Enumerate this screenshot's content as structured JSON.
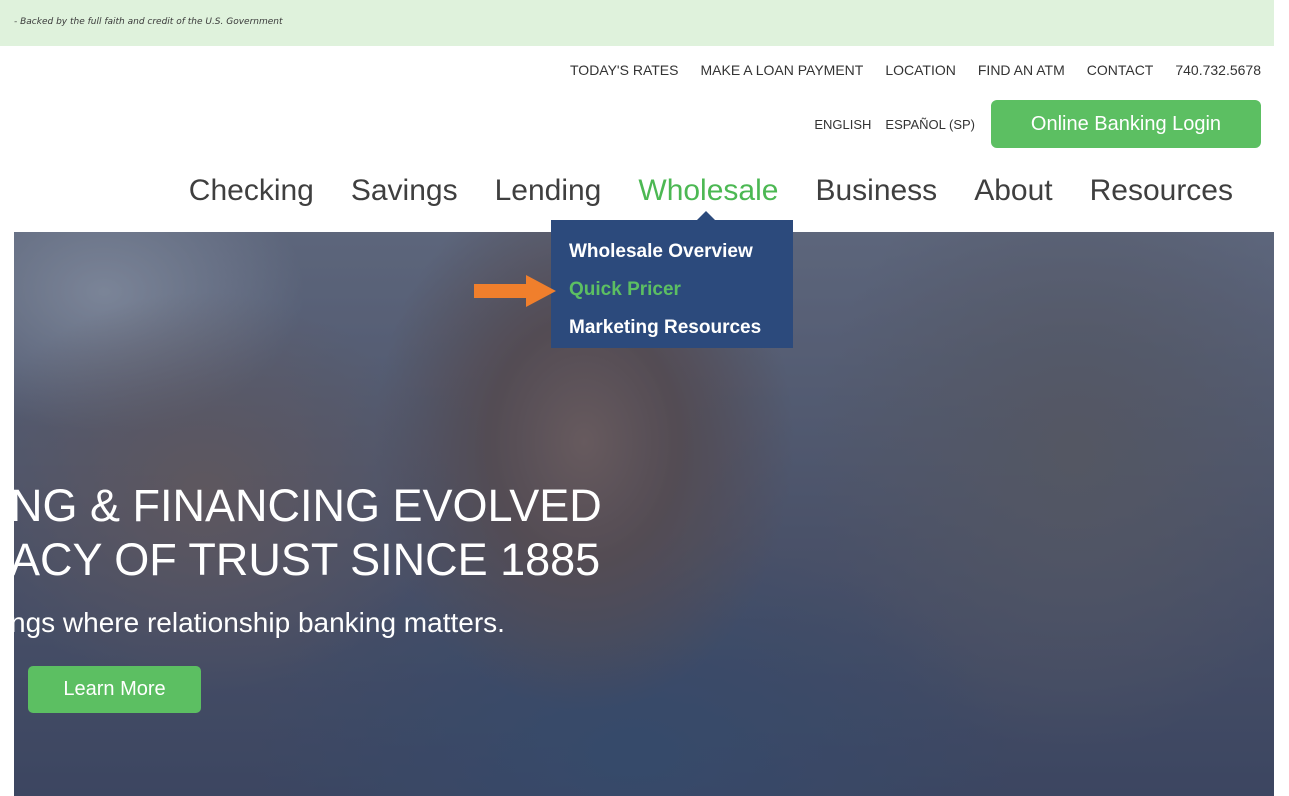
{
  "banner": {
    "text": "- Backed by the full faith and credit of the U.S. Government"
  },
  "utility_nav": {
    "items": [
      "TODAY'S RATES",
      "MAKE A LOAN PAYMENT",
      "LOCATION",
      "FIND AN ATM",
      "CONTACT"
    ],
    "phone": "740.732.5678"
  },
  "language": {
    "english": "ENGLISH",
    "spanish": "ESPAÑOL (SP)"
  },
  "login_button": "Online Banking Login",
  "main_nav": {
    "items": [
      "Checking",
      "Savings",
      "Lending",
      "Wholesale",
      "Business",
      "About",
      "Resources"
    ],
    "active": "Wholesale"
  },
  "dropdown": {
    "items": [
      "Wholesale Overview",
      "Quick Pricer",
      "Marketing Resources"
    ],
    "highlighted": "Quick Pricer"
  },
  "hero": {
    "line1": "NG & FINANCING EVOLVED",
    "line2": "ACY OF TRUST SINCE 1885",
    "subtitle": "ngs where relationship banking matters.",
    "button": "Learn More"
  },
  "colors": {
    "accent_green": "#5cbf62",
    "dropdown_bg": "#2c4a7c",
    "banner_bg": "#dff2dc",
    "arrow": "#f07f2c"
  },
  "icons": {
    "pointer": "arrow-right-icon"
  }
}
